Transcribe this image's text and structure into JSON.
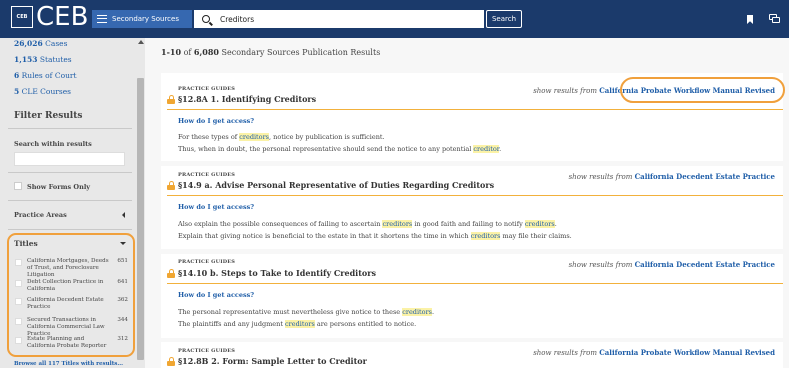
{
  "header": {
    "logo_small": "CEB",
    "logo_text": "CEB",
    "menu_label": "Secondary Sources",
    "search_value": "Creditors",
    "search_button": "Search",
    "icons": {
      "bookmark": "bookmark-icon",
      "chat": "chat-icon",
      "menu": "hamburger-icon",
      "search": "search-icon"
    }
  },
  "sidebar": {
    "links": [
      {
        "count": "26,026",
        "label": "Cases"
      },
      {
        "count": "1,153",
        "label": "Statutes"
      },
      {
        "count": "6",
        "label": "Rules of Court"
      },
      {
        "count": "5",
        "label": "CLE Courses"
      }
    ],
    "filter_title": "Filter Results",
    "search_within_label": "Search within results",
    "search_within_value": "",
    "forms_only_label": "Show Forms Only",
    "practice_areas_label": "Practice Areas",
    "titles_label": "Titles",
    "titles": [
      {
        "name": "California Mortgages, Deeds of Trust, and Foreclosure Litigation",
        "count": "651"
      },
      {
        "name": "Debt Collection Practice in California",
        "count": "641"
      },
      {
        "name": "California Decedent Estate Practice",
        "count": "362"
      },
      {
        "name": "Secured Transactions in California Commercial Law Practice",
        "count": "344"
      },
      {
        "name": "Estate Planning and California Probate Reporter",
        "count": "312"
      }
    ],
    "browse_link": "Browse all 117 Titles with results..."
  },
  "main": {
    "summary_range": "1-10",
    "summary_of": "of",
    "summary_total": "6,080",
    "summary_rest": "Secondary Sources Publication Results",
    "show_from_label": "show results from",
    "access_label": "How do I get access?",
    "results": [
      {
        "type": "PRACTICE GUIDES",
        "title": "§12.8A 1. Identifying Creditors",
        "source": "California Probate Workflow Manual Revised",
        "snippets": [
          [
            "For these types of ",
            "creditors",
            ", notice by publication is sufficient."
          ],
          [
            "Thus, when in doubt, the personal representative should send the notice to any potential ",
            "creditor",
            "."
          ]
        ]
      },
      {
        "type": "PRACTICE GUIDES",
        "title": "§14.9 a. Advise Personal Representative of Duties Regarding Creditors",
        "source": "California Decedent Estate Practice",
        "snippets": [
          [
            "Also explain the possible consequences of failing to ascertain ",
            "creditors",
            " in good faith and failing to notify ",
            "creditors",
            "."
          ],
          [
            "Explain that giving notice is beneficial to the estate in that it shortens the time in which ",
            "creditors",
            " may file their claims."
          ]
        ]
      },
      {
        "type": "PRACTICE GUIDES",
        "title": "§14.10 b. Steps to Take to Identify Creditors",
        "source": "California Decedent Estate Practice",
        "snippets": [
          [
            "The personal representative must nevertheless give notice to these ",
            "creditors",
            "."
          ],
          [
            "The plaintiffs and any judgment ",
            "creditors",
            " are persons entitled to notice."
          ]
        ]
      },
      {
        "type": "PRACTICE GUIDES",
        "title": "§12.8B 2. Form: Sample Letter to Creditor",
        "source": "California Probate Workflow Manual Revised",
        "snippets": []
      }
    ]
  },
  "colors": {
    "header": "#1b3a6b",
    "link": "#1f5ea8",
    "accent": "#f0a03c",
    "highlight": "#fbf2a6"
  }
}
